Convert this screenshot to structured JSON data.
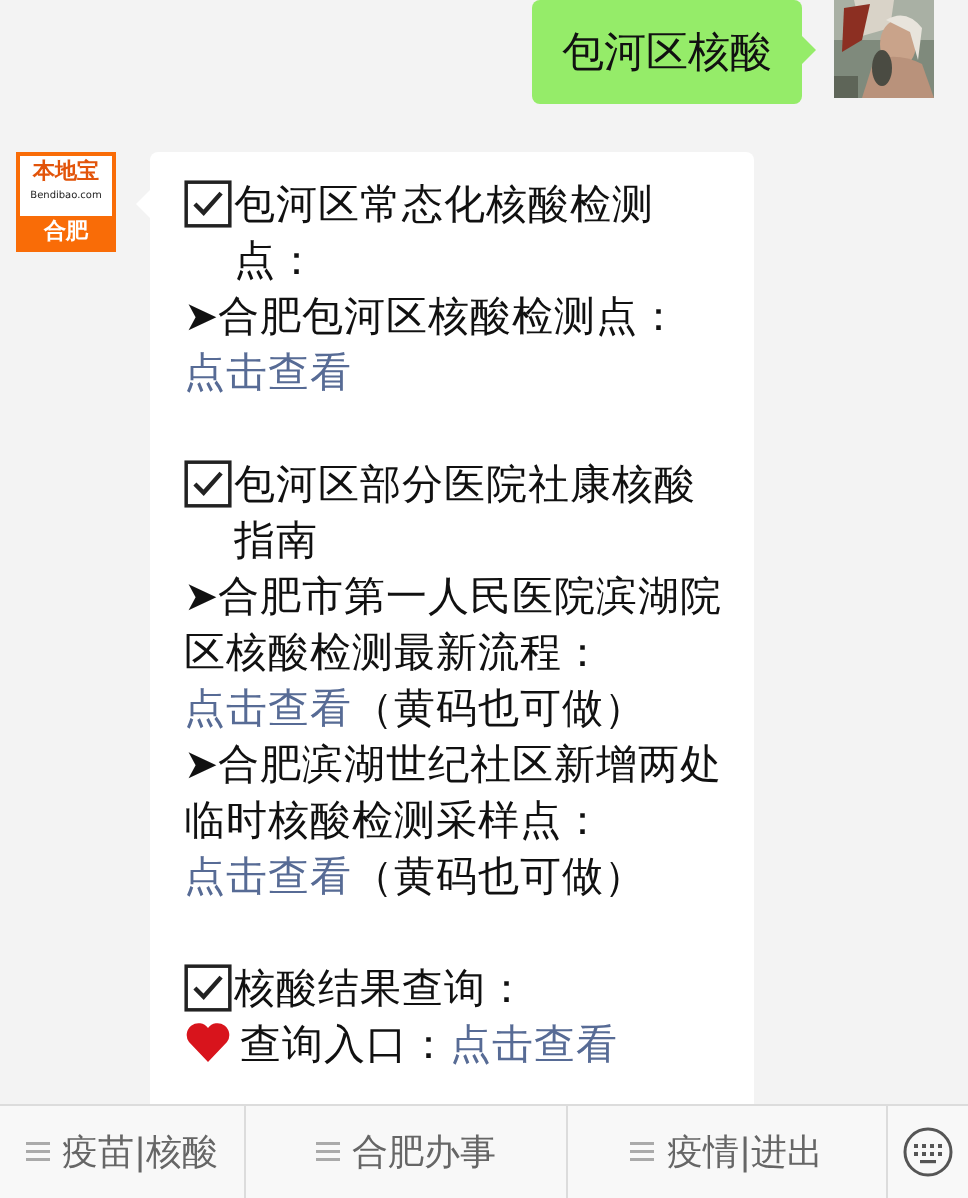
{
  "sent": {
    "text": "包河区核酸"
  },
  "received": {
    "logo": {
      "title": "本地宝",
      "subtitle": "Bendibao.com",
      "city": "合肥"
    },
    "blocks": [
      {
        "lines": [
          {
            "kind": "heading",
            "text": "包河区常态化核酸检测点："
          },
          {
            "kind": "bullet",
            "marker": "➤",
            "text": "合肥包河区核酸检测点：",
            "link": "点击查看"
          }
        ]
      },
      {
        "lines": [
          {
            "kind": "heading",
            "text": "包河区部分医院社康核酸指南"
          },
          {
            "kind": "bullet",
            "marker": "➤",
            "text": "合肥市第一人民医院滨湖院区核酸检测最新流程：",
            "link": "点击查看",
            "after": "（黄码也可做）"
          },
          {
            "kind": "bullet",
            "marker": "➤",
            "text": "合肥滨湖世纪社区新增两处临时核酸检测采样点：",
            "link": "点击查看",
            "after": "（黄码也可做）"
          }
        ]
      },
      {
        "lines": [
          {
            "kind": "heading",
            "text": "核酸结果查询："
          },
          {
            "kind": "heart",
            "text": "查询入口：",
            "link": "点击查看"
          }
        ]
      }
    ]
  },
  "menu": [
    {
      "label": "疫苗|核酸"
    },
    {
      "label": "合肥办事"
    },
    {
      "label": "疫情|进出"
    }
  ]
}
